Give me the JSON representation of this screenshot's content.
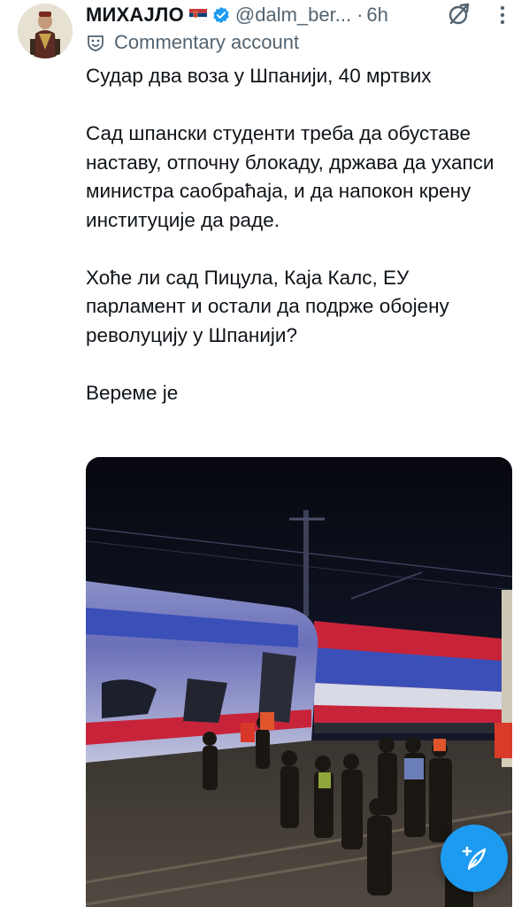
{
  "author": {
    "display_name": "МИХАЈЛО",
    "handle": "@dalm_ber...",
    "separator": "·",
    "time": "6h",
    "flag_icon": "serbia-flag-icon",
    "verified_icon": "verified-badge-icon",
    "avatar_icon": "avatar"
  },
  "label": {
    "text": "Commentary account",
    "icon": "theater-masks-icon"
  },
  "tweet": {
    "paragraphs": [
      "Судар два воза у Шпанији, 40 мртвих",
      "Сад шпански студенти треба да обуставе наставу, отпочну блокаду, држава да ухапси министра саобраћаја, и да напокон крену институције да раде.",
      "Хоће ли сад Пицула, Каја Калс, ЕУ парламент и остали да подрже обојену револуцију у Шпанији?",
      "Вереме је"
    ]
  },
  "media": {
    "kind": "photo",
    "icon": "train-crash-photo"
  },
  "actions": {
    "grok_icon": "grok-icon",
    "more_icon": "more-vertical-icon",
    "compose_icon": "compose-post-icon"
  },
  "colors": {
    "accent": "#1d9bf0",
    "secondary_text": "#536471",
    "primary_text": "#0f1419",
    "train_red": "#c7243a",
    "train_blue": "#3b4fb8"
  }
}
